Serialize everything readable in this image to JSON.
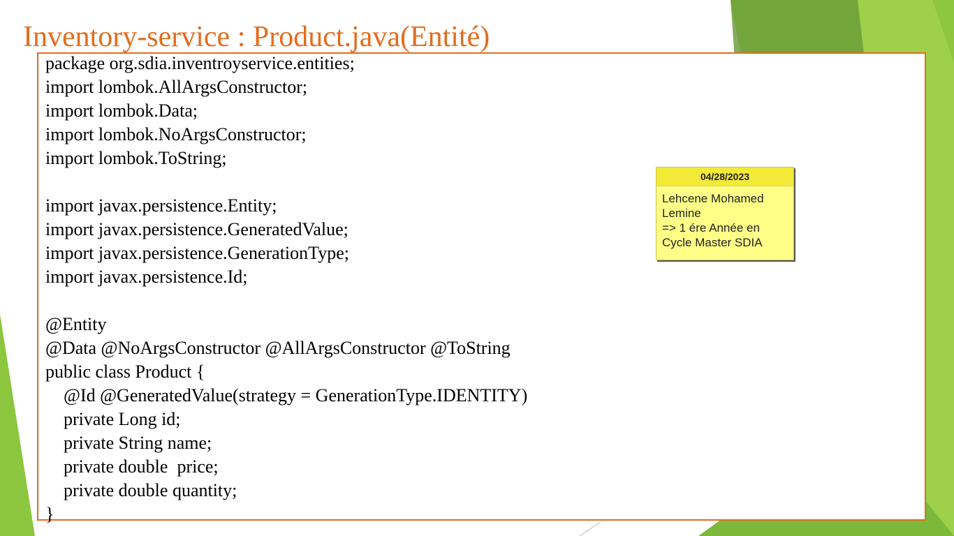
{
  "slide": {
    "title": "Inventory-service : Product.java(Entité)",
    "accent_color": "#e36c1d",
    "theme_greens": [
      "#8dc63f",
      "#6fa03a",
      "#5b8f32"
    ]
  },
  "code": {
    "lines": [
      "package org.sdia.inventroyservice.entities;",
      "import lombok.AllArgsConstructor;",
      "import lombok.Data;",
      "import lombok.NoArgsConstructor;",
      "import lombok.ToString;",
      "",
      "import javax.persistence.Entity;",
      "import javax.persistence.GeneratedValue;",
      "import javax.persistence.GenerationType;",
      "import javax.persistence.Id;",
      "",
      "@Entity",
      "@Data @NoArgsConstructor @AllArgsConstructor @ToString",
      "public class Product {",
      "    @Id @GeneratedValue(strategy = GenerationType.IDENTITY)",
      "    private Long id;",
      "    private String name;",
      "    private double  price;",
      "    private double quantity;",
      "}"
    ]
  },
  "note": {
    "date": "04/28/2023",
    "lines": [
      "Lehcene Mohamed",
      "Lemine",
      "=> 1 ére Année en",
      "Cycle Master SDIA"
    ]
  }
}
